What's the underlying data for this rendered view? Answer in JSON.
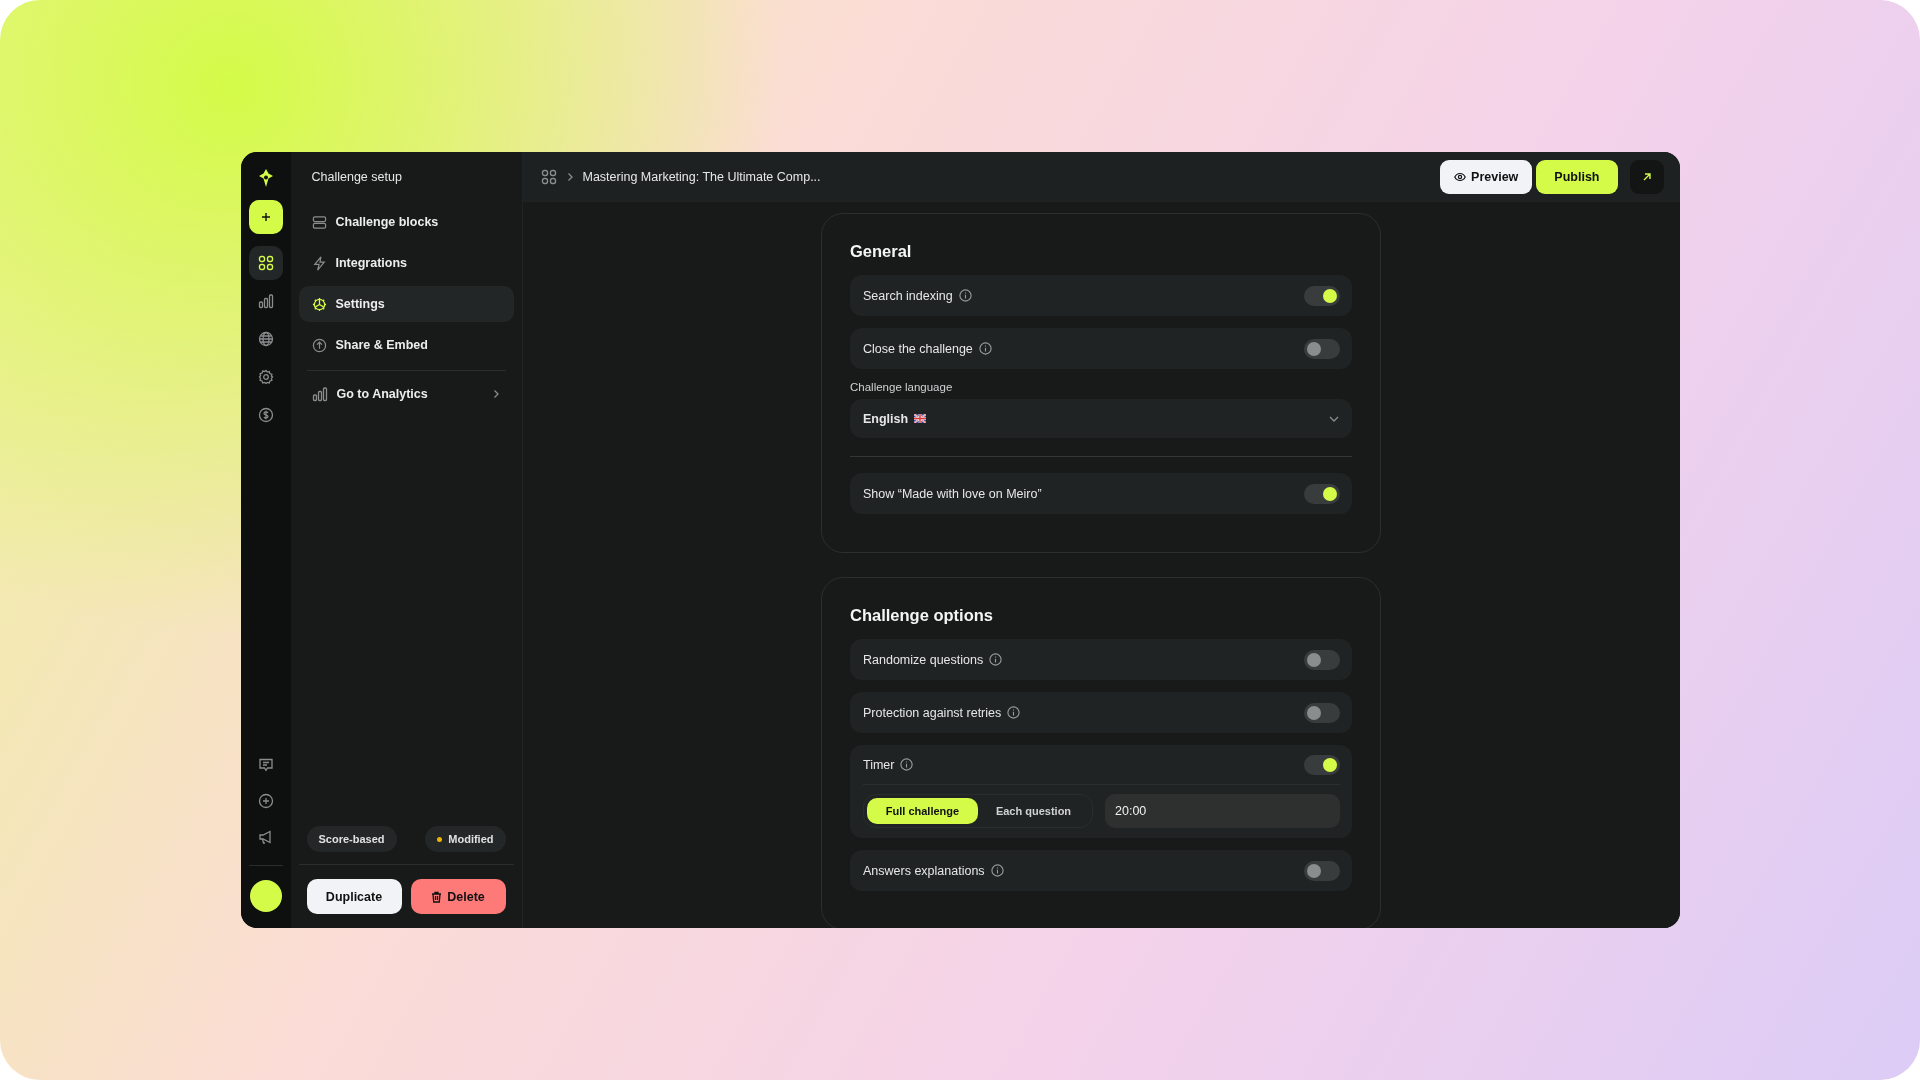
{
  "rail": {
    "items": [
      {
        "selected": true
      },
      {
        "selected": false
      },
      {
        "selected": false
      },
      {
        "selected": false
      },
      {
        "selected": false
      }
    ]
  },
  "sidebar": {
    "title": "Challenge setup",
    "items": [
      {
        "label": "Challenge blocks",
        "selected": false
      },
      {
        "label": "Integrations",
        "selected": false
      },
      {
        "label": "Settings",
        "selected": true
      },
      {
        "label": "Share & Embed",
        "selected": false
      }
    ],
    "analytics_link": "Go to Analytics",
    "tag": "Score-based",
    "status": {
      "label": "Modified",
      "color": "#f0b400"
    },
    "buttons": [
      {
        "label": "Duplicate",
        "kind": "secondary"
      },
      {
        "label": "Delete",
        "kind": "danger"
      }
    ]
  },
  "topbar": {
    "breadcrumb": "Mastering Marketing: The Ultimate Comp...",
    "buttons": [
      {
        "label": "Preview",
        "kind": "preview"
      },
      {
        "label": "Publish",
        "kind": "publish"
      }
    ]
  },
  "sections": [
    {
      "title": "General",
      "rows": [
        {
          "kind": "toggle",
          "label": "Search indexing",
          "info": true,
          "on": true
        },
        {
          "kind": "toggle",
          "label": "Close the challenge",
          "info": true,
          "on": false
        },
        {
          "kind": "select",
          "label": "Challenge language",
          "value": "English"
        },
        {
          "kind": "divider"
        },
        {
          "kind": "toggle",
          "label": "Show “Made with love on Meiro”",
          "info": false,
          "on": true
        }
      ]
    },
    {
      "title": "Challenge options",
      "rows": [
        {
          "kind": "toggle",
          "label": "Randomize questions",
          "info": true,
          "on": false
        },
        {
          "kind": "toggle",
          "label": "Protection against retries",
          "info": true,
          "on": false
        },
        {
          "kind": "timer",
          "label": "Timer",
          "info": true,
          "on": true,
          "modes": [
            {
              "label": "Full challenge",
              "selected": true
            },
            {
              "label": "Each question",
              "selected": false
            }
          ],
          "value": "20:00"
        },
        {
          "kind": "toggle",
          "label": "Answers explanations",
          "info": true,
          "on": false
        }
      ]
    }
  ]
}
